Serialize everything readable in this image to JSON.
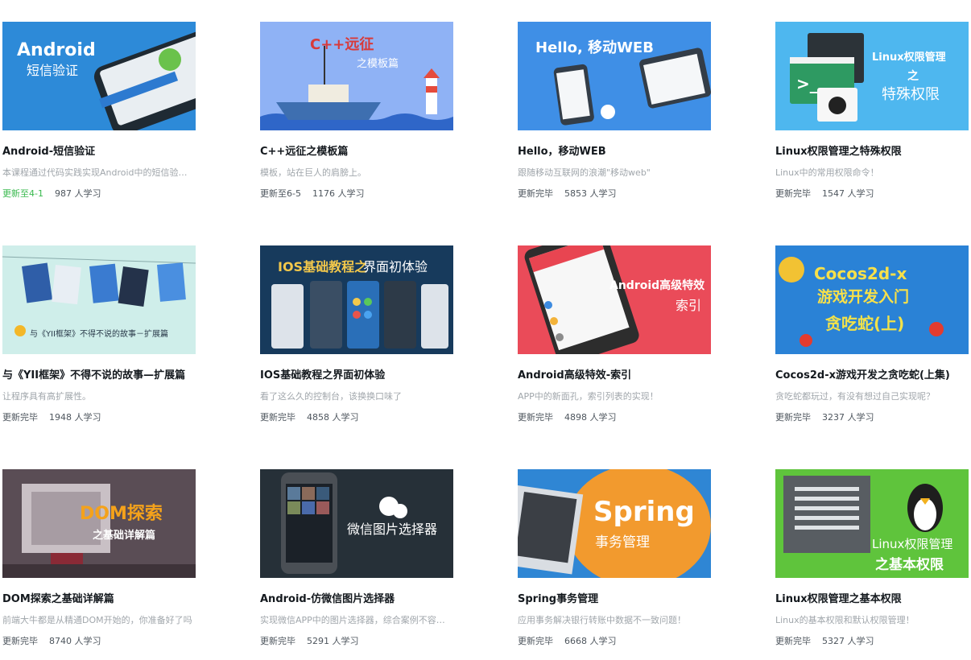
{
  "courses": [
    {
      "title": "Android-短信验证",
      "desc": "本课程通过代码实践实现Android中的短信验证功能",
      "status": "更新至4-1",
      "learners": "987 人学习",
      "status_color": "#39b94e",
      "thumb": {
        "line1": "Android",
        "line2": "短信验证",
        "bg": "#2d8ad8"
      }
    },
    {
      "title": "C++远征之模板篇",
      "desc": "模板，站在巨人的肩膀上。",
      "status": "更新至6-5",
      "learners": "1176 人学习",
      "thumb": {
        "line1": "C++远征",
        "line2": "之模板篇",
        "bg": "#8fb2f5"
      }
    },
    {
      "title": "Hello，移动WEB",
      "desc": "跟随移动互联网的浪潮\"移动web\"",
      "status": "更新完毕",
      "learners": "5853 人学习",
      "thumb": {
        "line1": "Hello, 移动WEB",
        "line2": "",
        "bg": "#3f8fe6"
      }
    },
    {
      "title": "Linux权限管理之特殊权限",
      "desc": "Linux中的常用权限命令！",
      "status": "更新完毕",
      "learners": "1547 人学习",
      "thumb": {
        "line1": "Linux权限管理",
        "line2": "之",
        "line3": "特殊权限",
        "bg": "#4eb7ef"
      }
    },
    {
      "title": "与《YII框架》不得不说的故事—扩展篇",
      "desc": "让程序具有高扩展性。",
      "status": "更新完毕",
      "learners": "1948 人学习",
      "thumb": {
        "line1": "与《YII框架》不得不说的故事－扩展篇",
        "line2": "",
        "bg": "#cfeeea"
      }
    },
    {
      "title": "IOS基础教程之界面初体验",
      "desc": "看了这么久的控制台，该换换口味了",
      "status": "更新完毕",
      "learners": "4858 人学习",
      "thumb": {
        "line1": "IOS基础教程之",
        "line2": "界面初体验",
        "bg": "#173a5c"
      }
    },
    {
      "title": "Android高级特效-索引",
      "desc": "APP中的新面孔，索引列表的实现！",
      "status": "更新完毕",
      "learners": "4898 人学习",
      "thumb": {
        "line1": "Android高级特效",
        "line2": "索引",
        "bg": "#ea4b59"
      }
    },
    {
      "title": "Cocos2d-x游戏开发之贪吃蛇(上集)",
      "desc": "贪吃蛇都玩过，有没有想过自己实现呢？",
      "status": "更新完毕",
      "learners": "3237 人学习",
      "thumb": {
        "line1": "Cocos2d-x",
        "line2": "游戏开发入门",
        "line3": "贪吃蛇(上)",
        "bg": "#2a82d6"
      }
    },
    {
      "title": "DOM探索之基础详解篇",
      "desc": "前端大牛都是从精通DOM开始的，你准备好了吗",
      "status": "更新完毕",
      "learners": "8740 人学习",
      "thumb": {
        "line1": "DOM探索",
        "line2": "之基础详解篇",
        "bg": "#5a4d55"
      }
    },
    {
      "title": "Android-仿微信图片选择器",
      "desc": "实现微信APP中的图片选择器，综合案例不容错过",
      "status": "更新完毕",
      "learners": "5291 人学习",
      "thumb": {
        "line1": "微信图片选择器",
        "line2": "",
        "bg": "#263038"
      }
    },
    {
      "title": "Spring事务管理",
      "desc": "应用事务解决银行转账中数据不一致问题！",
      "status": "更新完毕",
      "learners": "6668 人学习",
      "thumb": {
        "line1": "Spring",
        "line2": "事务管理",
        "bg": "#2f86d4"
      }
    },
    {
      "title": "Linux权限管理之基本权限",
      "desc": "Linux的基本权限和默认权限管理！",
      "status": "更新完毕",
      "learners": "5327 人学习",
      "thumb": {
        "line1": "Linux权限管理",
        "line2": "之基本权限",
        "bg": "#5fc43c"
      }
    }
  ]
}
